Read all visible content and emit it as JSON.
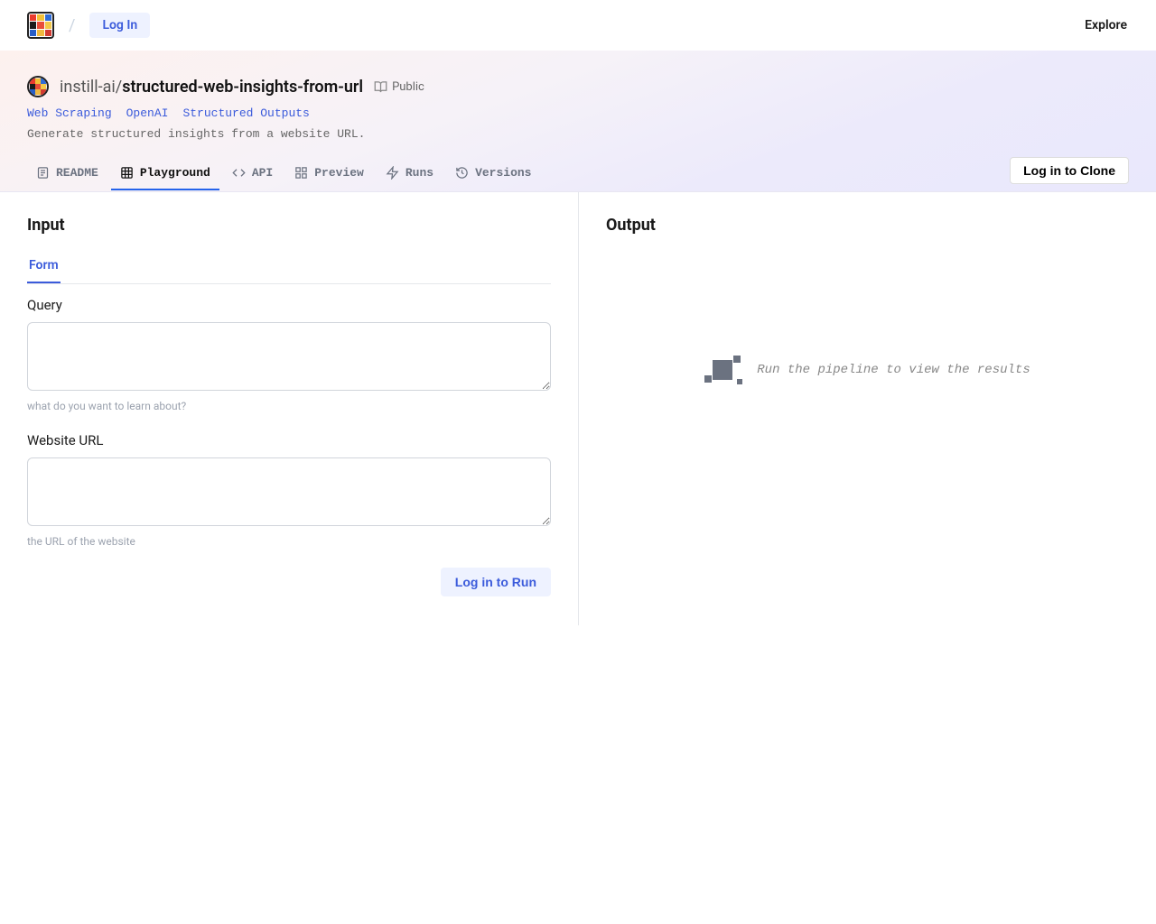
{
  "nav": {
    "login": "Log In",
    "explore": "Explore"
  },
  "header": {
    "owner": "instill-ai",
    "slash": "/",
    "name": "structured-web-insights-from-url",
    "visibility": "Public",
    "tags": [
      "Web Scraping",
      "OpenAI",
      "Structured Outputs"
    ],
    "description": "Generate structured insights from a website URL."
  },
  "tabs": [
    {
      "id": "readme",
      "label": "README"
    },
    {
      "id": "playground",
      "label": "Playground"
    },
    {
      "id": "api",
      "label": "API"
    },
    {
      "id": "preview",
      "label": "Preview"
    },
    {
      "id": "runs",
      "label": "Runs"
    },
    {
      "id": "versions",
      "label": "Versions"
    }
  ],
  "active_tab": "playground",
  "clone_button": "Log in to Clone",
  "playground": {
    "input_title": "Input",
    "output_title": "Output",
    "form_tab": "Form",
    "fields": {
      "query": {
        "label": "Query",
        "value": "",
        "helper": "what do you want to learn about?"
      },
      "website": {
        "label": "Website URL",
        "value": "",
        "helper": "the URL of the website"
      }
    },
    "run_button": "Log in to Run",
    "output_empty_msg": "Run the pipeline to view the results"
  },
  "logo_colors": [
    "#ea3b2e",
    "#f2c037",
    "#2e6bd6",
    "#1b1b1b",
    "#e94d3a",
    "#f3c94a",
    "#285ec7",
    "#efb940",
    "#d23b32"
  ]
}
